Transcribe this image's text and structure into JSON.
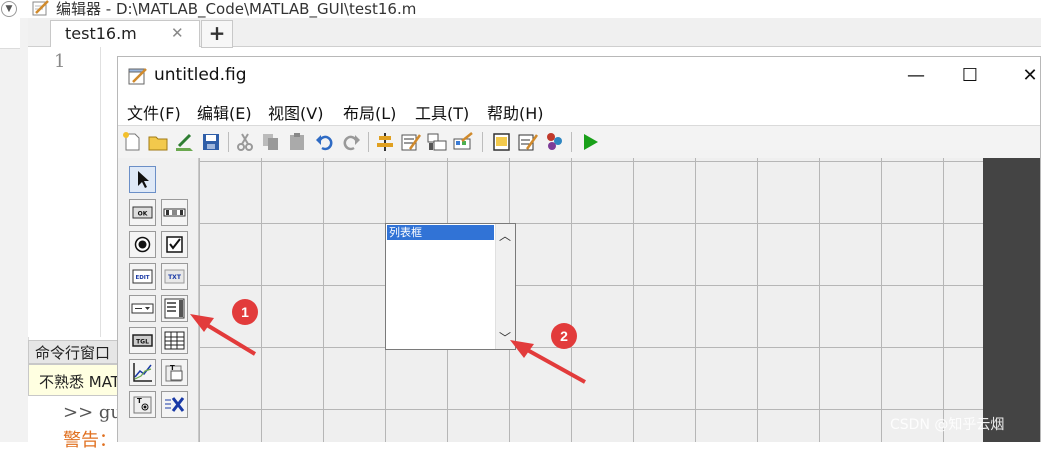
{
  "editor": {
    "title": "编辑器 - D:\\MATLAB_Code\\MATLAB_GUI\\test16.m",
    "collapse_icon": "chevron-down-icon",
    "tab_label": "test16.m",
    "tab_close": "✕",
    "tab_add": "+",
    "line_number": "1"
  },
  "command_window": {
    "title": "命令行窗口",
    "hint": "不熟悉 MATLAB？",
    "prompt": ">>  gu",
    "warning": "警告："
  },
  "guide": {
    "title": "untitled.fig",
    "window_buttons": {
      "minimize": "—",
      "maximize": "☐",
      "close": "✕"
    },
    "menu": [
      "文件(F)",
      "编辑(E)",
      "视图(V)",
      "布局(L)",
      "工具(T)",
      "帮助(H)"
    ],
    "toolbar_icons": [
      "new-icon",
      "open-icon",
      "edit-icon",
      "save-icon",
      "cut-icon",
      "copy-icon",
      "paste-icon",
      "undo-icon",
      "redo-icon",
      "align-icon",
      "menu-editor-icon",
      "tab-order-icon",
      "toolbar-editor-icon",
      "mfile-editor-icon",
      "property-inspector-icon",
      "object-browser-icon",
      "run-icon"
    ],
    "palette_icons": [
      "select-pointer-icon",
      "push-button-icon",
      "slider-icon",
      "radio-button-icon",
      "checkbox-icon",
      "edit-text-icon",
      "static-text-icon",
      "popup-menu-icon",
      "listbox-icon",
      "toggle-button-icon",
      "table-icon",
      "axes-icon",
      "panel-icon",
      "button-group-icon",
      "activex-icon"
    ],
    "palette_labels": {
      "push": "OK",
      "edit": "EDIT",
      "text": "TXT",
      "toggle": "TGL"
    },
    "listbox": {
      "item": "列表框"
    }
  },
  "annotations": {
    "badge1": "1",
    "badge2": "2"
  },
  "watermark": "CSDN @知乎云烟",
  "colors": {
    "selection": "#3173d6",
    "badge": "#e23b3b",
    "run": "#19a019"
  }
}
